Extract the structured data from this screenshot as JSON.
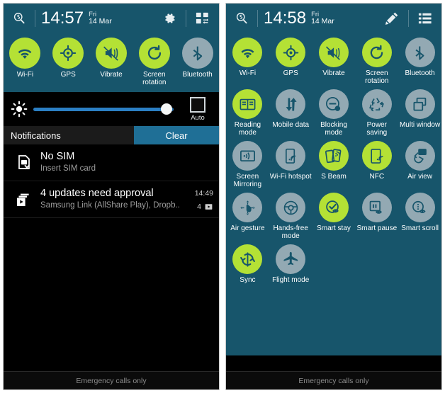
{
  "panels": [
    {
      "id": "notification-panel",
      "statusbar": {
        "search_icon": "search-icon",
        "time": "14:57",
        "day": "Fri",
        "date": "14 Mar",
        "action_icons": [
          "settings-gear-icon",
          "quick-settings-grid-icon"
        ]
      },
      "quick_toggles": [
        {
          "label": "Wi-Fi",
          "icon": "wifi-icon",
          "state": "on"
        },
        {
          "label": "GPS",
          "icon": "gps-icon",
          "state": "on"
        },
        {
          "label": "Vibrate",
          "icon": "vibrate-icon",
          "state": "on"
        },
        {
          "label": "Screen rotation",
          "icon": "screen-rotation-icon",
          "state": "on"
        },
        {
          "label": "Bluetooth",
          "icon": "bluetooth-icon",
          "state": "off"
        }
      ],
      "brightness": {
        "icon": "brightness-icon",
        "value": 100,
        "auto_label": "Auto",
        "auto_checked": false
      },
      "notifications_header": {
        "title": "Notifications",
        "clear_label": "Clear"
      },
      "notifications": [
        {
          "icon": "no-sim-icon",
          "title": "No SIM",
          "subtitle": "Insert SIM card",
          "time": "",
          "count": ""
        },
        {
          "icon": "play-store-updates-icon",
          "title": "4 updates need approval",
          "subtitle": "Samsung Link (AllShare Play), Dropb..",
          "time": "14:49",
          "count": "4"
        }
      ],
      "footer": "Emergency calls only"
    },
    {
      "id": "quick-settings-panel",
      "statusbar": {
        "search_icon": "search-icon",
        "time": "14:58",
        "day": "Fri",
        "date": "14 Mar",
        "action_icons": [
          "edit-pencil-icon",
          "list-view-icon"
        ]
      },
      "quick_toggles": [
        {
          "label": "Wi-Fi",
          "icon": "wifi-icon",
          "state": "on"
        },
        {
          "label": "GPS",
          "icon": "gps-icon",
          "state": "on"
        },
        {
          "label": "Vibrate",
          "icon": "vibrate-icon",
          "state": "on"
        },
        {
          "label": "Screen rotation",
          "icon": "screen-rotation-icon",
          "state": "on"
        },
        {
          "label": "Bluetooth",
          "icon": "bluetooth-icon",
          "state": "off"
        },
        {
          "label": "Reading mode",
          "icon": "reading-mode-icon",
          "state": "on"
        },
        {
          "label": "Mobile data",
          "icon": "mobile-data-icon",
          "state": "off"
        },
        {
          "label": "Blocking mode",
          "icon": "blocking-mode-icon",
          "state": "off"
        },
        {
          "label": "Power saving",
          "icon": "power-saving-icon",
          "state": "off"
        },
        {
          "label": "Multi window",
          "icon": "multi-window-icon",
          "state": "off"
        },
        {
          "label": "Screen Mirroring",
          "icon": "screen-mirroring-icon",
          "state": "off"
        },
        {
          "label": "Wi-Fi hotspot",
          "icon": "wifi-hotspot-icon",
          "state": "off"
        },
        {
          "label": "S Beam",
          "icon": "s-beam-icon",
          "state": "on"
        },
        {
          "label": "NFC",
          "icon": "nfc-icon",
          "state": "on"
        },
        {
          "label": "Air view",
          "icon": "air-view-icon",
          "state": "off"
        },
        {
          "label": "Air gesture",
          "icon": "air-gesture-icon",
          "state": "off"
        },
        {
          "label": "Hands-free mode",
          "icon": "hands-free-mode-icon",
          "state": "off"
        },
        {
          "label": "Smart stay",
          "icon": "smart-stay-icon",
          "state": "on"
        },
        {
          "label": "Smart pause",
          "icon": "smart-pause-icon",
          "state": "off"
        },
        {
          "label": "Smart scroll",
          "icon": "smart-scroll-icon",
          "state": "off"
        },
        {
          "label": "Sync",
          "icon": "sync-icon",
          "state": "on"
        },
        {
          "label": "Flight mode",
          "icon": "flight-mode-icon",
          "state": "off"
        }
      ],
      "footer": "Emergency calls only"
    }
  ],
  "colors": {
    "panel_teal": "#17556b",
    "toggle_on": "#b4e135",
    "toggle_off": "#93a9b3",
    "icon_dark": "#17556b",
    "slider_blue": "#2b7fc4",
    "clear_button": "#1f6f96"
  }
}
